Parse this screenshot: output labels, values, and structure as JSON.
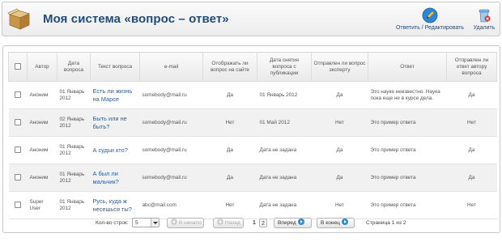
{
  "header": {
    "title": "Моя система «вопрос – ответ»",
    "answer_edit_label": "Ответить / Редактировать",
    "delete_label": "Удалить"
  },
  "grid": {
    "columns": [
      "Автор",
      "Дата вопроса",
      "Текст вопроса",
      "e-mail",
      "Отображать ли вопрос на сайте",
      "Дата снятия вопроса с публикации",
      "Отправлен ли вопрос эксперту",
      "Ответ",
      "Отправлен ли ответ автору вопроса"
    ],
    "rows": [
      {
        "author": "Аноним",
        "date": "01 Январь 2012",
        "question": "Есть ли жизнь на Марсе",
        "email": "somebody@mail.ru",
        "show": "Да",
        "unpublish": "01 Январь 2012",
        "expert": "Да",
        "answer": "Это науке неизвестно. Наука пока еще не в курсе дела.",
        "sent": "Да"
      },
      {
        "author": "Аноним",
        "date": "02 Январь 2012",
        "question": "Быть или не быть?",
        "email": "somebody@mail.ru",
        "show": "Нет",
        "unpublish": "01 Май 2012",
        "expert": "Нет",
        "answer": "Это пример ответа",
        "sent": "Нет"
      },
      {
        "author": "Аноним",
        "date": "01 Январь 2012",
        "question": "А судьи кто?",
        "email": "somebody@mail.ru",
        "show": "Да",
        "unpublish": "Дата не задана",
        "expert": "Да",
        "answer": "Это пример ответа",
        "sent": "Да"
      },
      {
        "author": "Аноним",
        "date": "01 Январь 2012",
        "question": "А был ли мальчик?",
        "email": "somebody@mail.ru",
        "show": "Да",
        "unpublish": "Дата не задана",
        "expert": "Да",
        "answer": "Это пример ответа",
        "sent": "Да"
      },
      {
        "author": "Super User",
        "date": "01 Январь 2012",
        "question": "Русь, куда ж несешься ты?",
        "email": "abc@mail.com",
        "show": "Нет",
        "unpublish": "Дата не задана",
        "expert": "Нет",
        "answer": "Это пример ответа",
        "sent": "Нет"
      }
    ]
  },
  "pager": {
    "rows_label": "Кол-во строк:",
    "rows_value": "5",
    "first_label": "В начало",
    "prev_label": "Назад",
    "pages": [
      "1",
      "2"
    ],
    "next_label": "Вперед",
    "last_label": "В конец",
    "info": "Страница 1 из 2"
  },
  "icons": {
    "header": "box-icon",
    "answer": "pencil-icon",
    "delete": "trash-icon"
  },
  "colors": {
    "title": "#1f4c7a",
    "link": "#2b5c9a",
    "accent": "#2f86d4"
  }
}
